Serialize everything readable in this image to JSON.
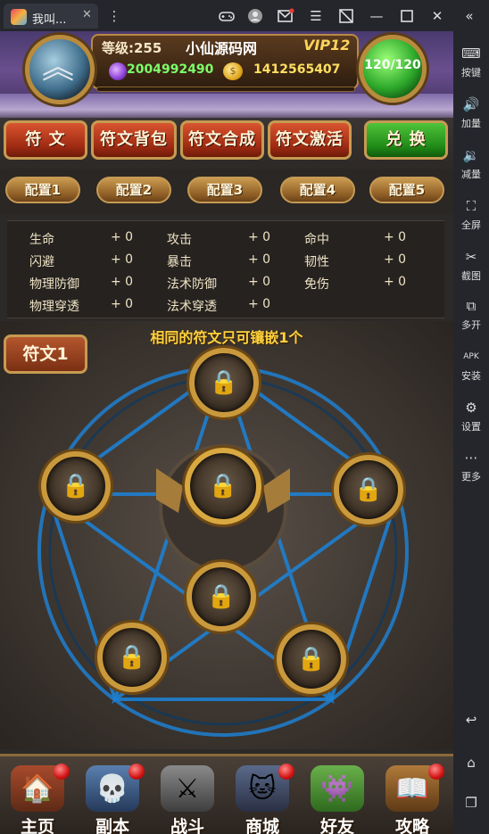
{
  "window": {
    "tab_title": "我叫...",
    "tab_close": "✕",
    "toolbar_icons": [
      "gamepad-icon",
      "account-icon",
      "mail-icon",
      "menu-icon",
      "screen-rotate-icon",
      "minimize-icon",
      "maximize-icon",
      "close-icon",
      "collapse-icon"
    ]
  },
  "sidebar": {
    "items": [
      {
        "icon": "keyboard-icon",
        "label": "按键"
      },
      {
        "icon": "volume-up-icon",
        "label": "加量"
      },
      {
        "icon": "volume-down-icon",
        "label": "减量"
      },
      {
        "icon": "fullscreen-icon",
        "label": "全屏"
      },
      {
        "icon": "scissors-icon",
        "label": "截图"
      },
      {
        "icon": "multi-open-icon",
        "label": "多开"
      },
      {
        "icon": "apk-icon",
        "label": "安装"
      },
      {
        "icon": "settings-icon",
        "label": "设置"
      },
      {
        "icon": "more-icon",
        "label": "更多"
      }
    ],
    "bottom_icons": [
      "back-icon",
      "home-icon",
      "recent-apps-icon"
    ]
  },
  "header": {
    "level": "等级:255",
    "site_name": "小仙源码网",
    "vip": "VIP12",
    "gems": "2004992490",
    "gold": "1412565407",
    "stamina": "120/120"
  },
  "tabs": [
    {
      "label": "符 文",
      "style": "red"
    },
    {
      "label": "符文背包",
      "style": "red"
    },
    {
      "label": "符文合成",
      "style": "red"
    },
    {
      "label": "符文激活",
      "style": "red"
    },
    {
      "label": "兑 换",
      "style": "green"
    }
  ],
  "configs": [
    "配置1",
    "配置2",
    "配置3",
    "配置4",
    "配置5"
  ],
  "stats": [
    {
      "label": "生命",
      "value": "+ 0"
    },
    {
      "label": "攻击",
      "value": "+ 0"
    },
    {
      "label": "命中",
      "value": "+ 0"
    },
    {
      "label": "闪避",
      "value": "+ 0"
    },
    {
      "label": "暴击",
      "value": "+ 0"
    },
    {
      "label": "韧性",
      "value": "+ 0"
    },
    {
      "label": "物理防御",
      "value": "+ 0"
    },
    {
      "label": "法术防御",
      "value": "+ 0"
    },
    {
      "label": "免伤",
      "value": "+ 0"
    },
    {
      "label": "物理穿透",
      "value": "+ 0"
    },
    {
      "label": "法术穿透",
      "value": "+ 0"
    }
  ],
  "rune": {
    "slot_label": "符文1",
    "notice": "相同的符文只可镶嵌1个",
    "lock_glyph": "🔒"
  },
  "bottom_nav": [
    {
      "label": "主页",
      "badge": true
    },
    {
      "label": "副本",
      "badge": true
    },
    {
      "label": "战斗",
      "badge": false
    },
    {
      "label": "商城",
      "badge": true
    },
    {
      "label": "好友",
      "badge": false
    },
    {
      "label": "攻略",
      "badge": true
    }
  ],
  "colors": {
    "accent_gold": "#c69a52",
    "tab_red": "#9e2a12",
    "tab_green": "#1f8a17",
    "notice_yellow": "#ffd23c",
    "pentagram_blue": "#1e7fd0"
  }
}
